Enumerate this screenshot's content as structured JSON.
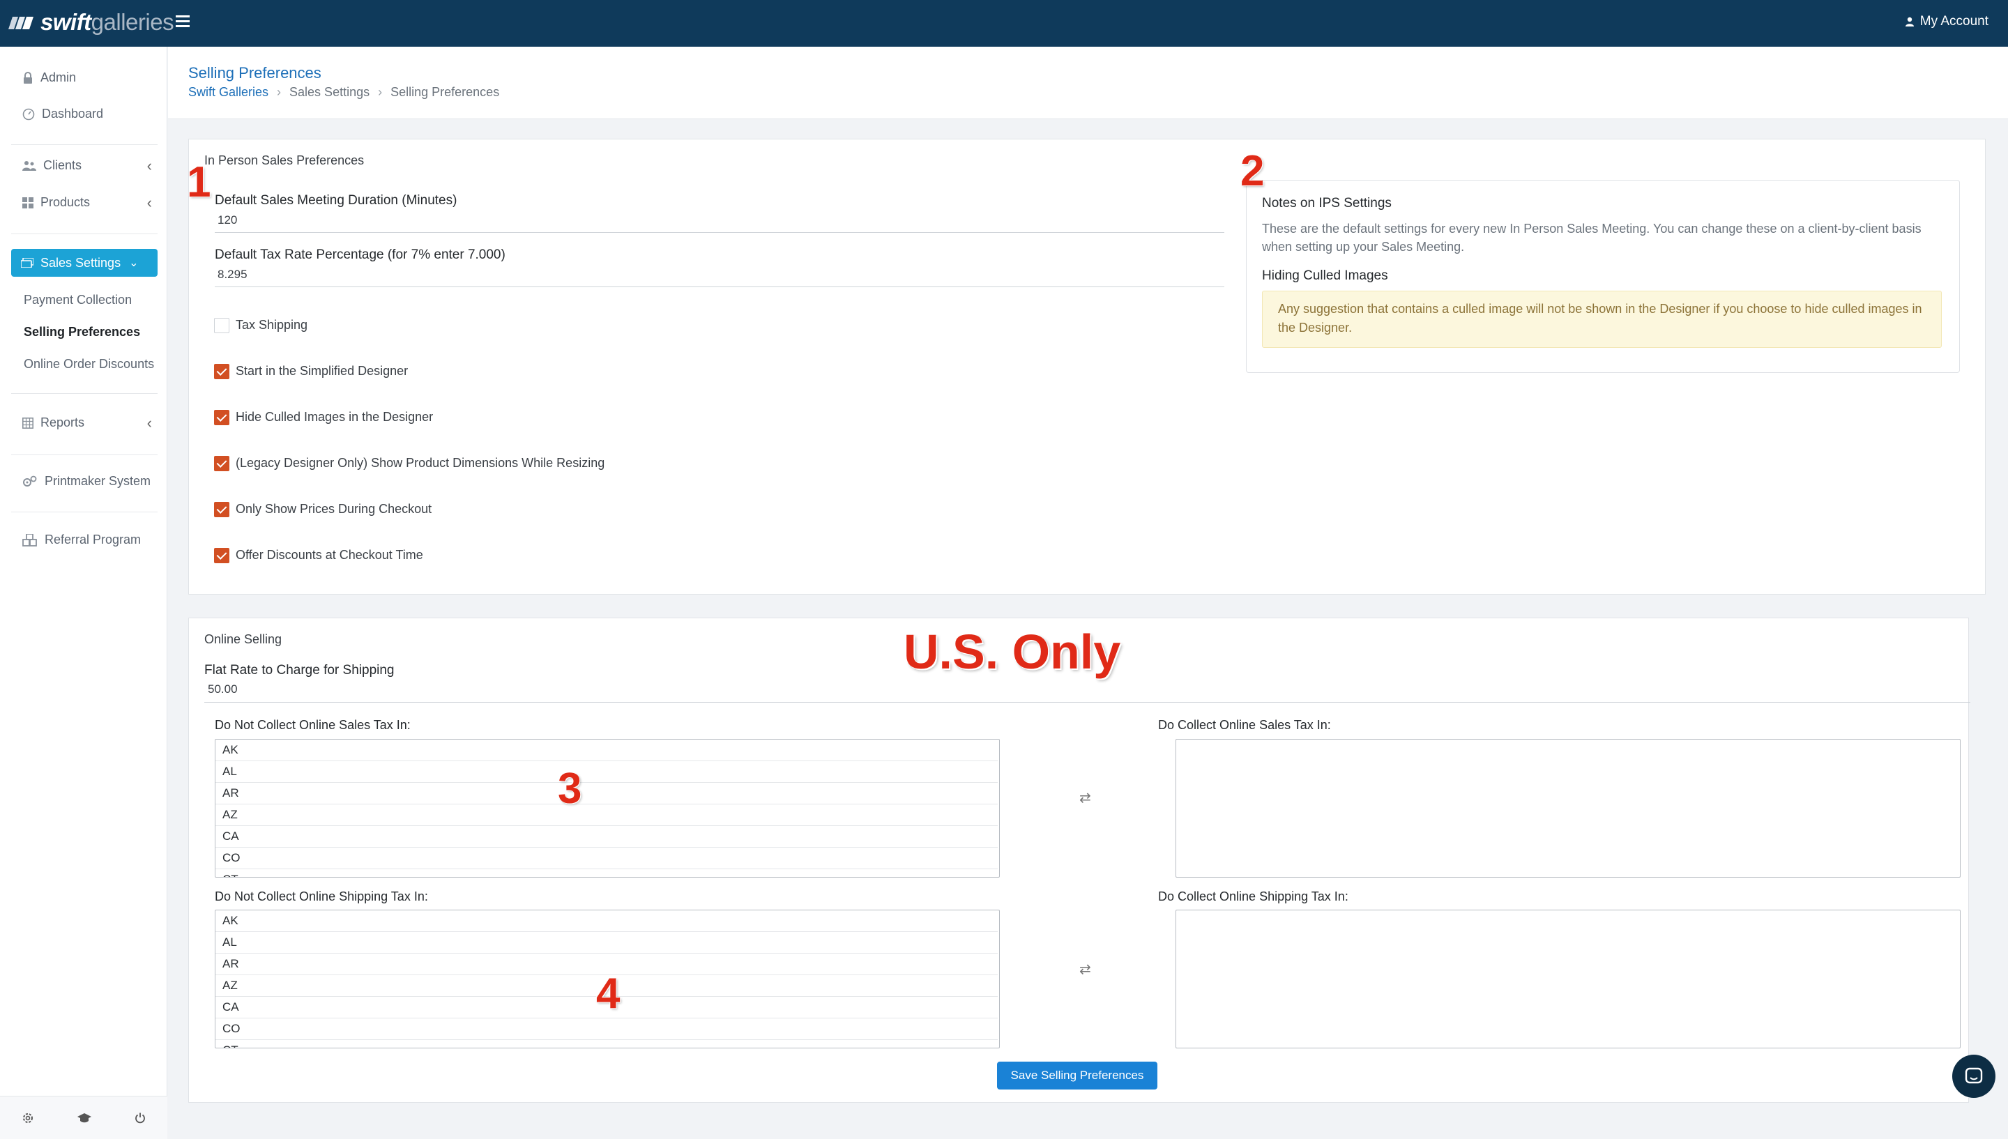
{
  "app": {
    "logo_part1": "swift",
    "logo_part2": "galleries",
    "account_label": "My Account"
  },
  "sidebar": {
    "admin": "Admin",
    "dashboard": "Dashboard",
    "clients": "Clients",
    "products": "Products",
    "sales_settings": "Sales Settings",
    "sub": [
      "Payment Collection",
      "Selling Preferences",
      "Online Order Discounts"
    ],
    "reports": "Reports",
    "printmaker": "Printmaker System",
    "referral": "Referral Program"
  },
  "header": {
    "title": "Selling Preferences",
    "breadcrumb": [
      "Swift Galleries",
      "Sales Settings",
      "Selling Preferences"
    ]
  },
  "in_person": {
    "section_title": "In Person Sales Preferences",
    "duration_label": "Default Sales Meeting Duration (Minutes)",
    "duration_value": "120",
    "tax_label": "Default Tax Rate Percentage (for 7% enter 7.000)",
    "tax_value": "8.295",
    "checkboxes": [
      {
        "label": "Tax Shipping",
        "checked": false
      },
      {
        "label": "Start in the Simplified Designer",
        "checked": true
      },
      {
        "label": "Hide Culled Images in the Designer",
        "checked": true
      },
      {
        "label": "(Legacy Designer Only) Show Product Dimensions While Resizing",
        "checked": true
      },
      {
        "label": "Only Show Prices During Checkout",
        "checked": true
      },
      {
        "label": "Offer Discounts at Checkout Time",
        "checked": true
      }
    ]
  },
  "notes": {
    "title": "Notes on IPS Settings",
    "text": "These are the default settings for every new In Person Sales Meeting. You can change these on a client-by-client basis when setting up your Sales Meeting.",
    "sub_title": "Hiding Culled Images",
    "warning": "Any suggestion that contains a culled image will not be shown in the Designer if you choose to hide culled images in the Designer."
  },
  "online": {
    "section_title": "Online Selling",
    "flat_rate_label": "Flat Rate to Charge for Shipping",
    "flat_rate_value": "50.00",
    "no_sales_tax_label": "Do Not Collect Online Sales Tax In:",
    "sales_tax_label": "Do Collect Online Sales Tax In:",
    "no_ship_tax_label": "Do Not Collect Online Shipping Tax In:",
    "ship_tax_label": "Do Collect Online Shipping Tax In:",
    "states": [
      "AK",
      "AL",
      "AR",
      "AZ",
      "CA",
      "CO",
      "CT"
    ],
    "swap_symbol": "⇄",
    "save_label": "Save Selling Preferences"
  },
  "annotations": {
    "n1": "1",
    "n2": "2",
    "n3": "3",
    "n4": "4",
    "us_only": "U.S. Only"
  },
  "colors": {
    "topbar": "#0f3a5b",
    "accent": "#1ca3d6",
    "checkbox": "#d24f22",
    "annotation": "#e02a17",
    "save": "#1a82d6"
  }
}
